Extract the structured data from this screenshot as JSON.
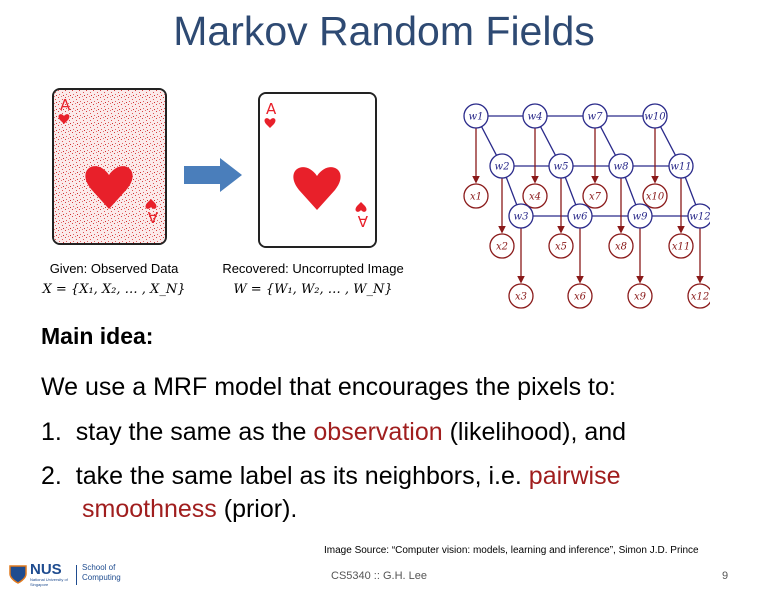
{
  "title": "Markov Random Fields",
  "left_image": {
    "caption": "Given: Observed Data",
    "formula": "X = {X₁, X₂, … , X_N}"
  },
  "right_image": {
    "caption": "Recovered: Uncorrupted Image",
    "formula": "W = {W₁, W₂, … , W_N}"
  },
  "card_rank": "A",
  "graph": {
    "hidden_nodes": [
      "w1",
      "w2",
      "w3",
      "w4",
      "w5",
      "w6",
      "w7",
      "w8",
      "w9",
      "w10",
      "w11",
      "w12"
    ],
    "observed_nodes": [
      "x1",
      "x2",
      "x3",
      "x4",
      "x5",
      "x6",
      "x7",
      "x8",
      "x9",
      "x10",
      "x11",
      "x12"
    ]
  },
  "main_idea": "Main idea:",
  "intro": "We use a MRF model that encourages the pixels to:",
  "items": [
    {
      "num": "1.",
      "pre": "stay the same as the ",
      "hl": "observation",
      "post": " (likelihood), and"
    },
    {
      "num": "2.",
      "pre": "take the same label as its neighbors, i.e. ",
      "hl": "pairwise",
      "line2_hl": "smoothness",
      "line2_post": " (prior)."
    }
  ],
  "source": "Image Source: “Computer vision: models, learning and inference”, Simon J.D. Prince",
  "footer": {
    "logo_text": "NUS",
    "logo_sub": "National University of Singapore",
    "school_line1": "School of",
    "school_line2": "Computing",
    "course": "CS5340 :: G.H. Lee",
    "page": "9"
  },
  "colors": {
    "title": "#2e4a73",
    "highlight": "#a01e1e",
    "arrow": "#4a7ebb",
    "heart": "#e8202a",
    "hidden_node": "#2a2a8a",
    "observed_node": "#8a1a1a"
  }
}
